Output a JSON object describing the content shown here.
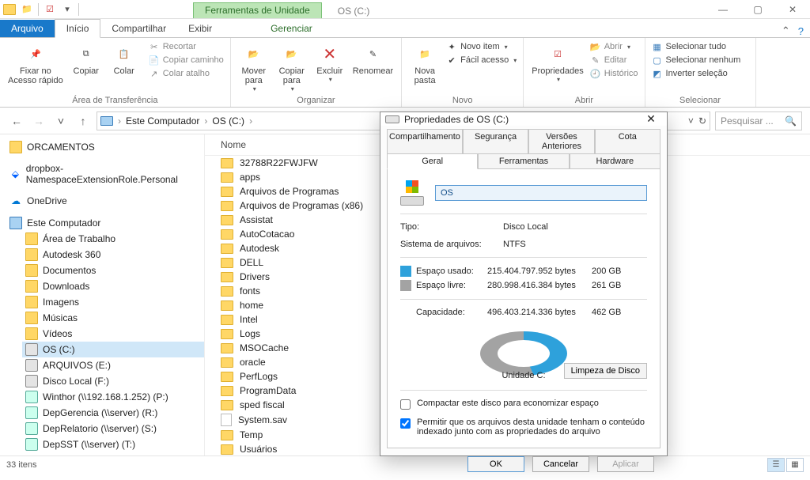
{
  "window": {
    "contextual_tab": "Ferramentas de Unidade",
    "title": "OS (C:)",
    "controls": {
      "min": "—",
      "max": "▢",
      "close": "✕"
    }
  },
  "ribbon_tabs": {
    "file": "Arquivo",
    "home": "Início",
    "share": "Compartilhar",
    "view": "Exibir",
    "manage": "Gerenciar",
    "help": "?",
    "collapse": "⌃"
  },
  "ribbon": {
    "clipboard": {
      "pin": "Fixar no",
      "pin2": "Acesso rápido",
      "copy": "Copiar",
      "paste": "Colar",
      "cut": "Recortar",
      "copy_path": "Copiar caminho",
      "paste_shortcut": "Colar atalho",
      "group": "Área de Transferência"
    },
    "organize": {
      "move_to": "Mover\npara",
      "copy_to": "Copiar\npara",
      "delete": "Excluir",
      "rename": "Renomear",
      "group": "Organizar"
    },
    "new": {
      "new_folder": "Nova\npasta",
      "new_item": "Novo item",
      "easy_access": "Fácil acesso",
      "group": "Novo"
    },
    "open": {
      "properties": "Propriedades",
      "open": "Abrir",
      "edit": "Editar",
      "history": "Histórico",
      "group": "Abrir"
    },
    "select": {
      "all": "Selecionar tudo",
      "none": "Selecionar nenhum",
      "invert": "Inverter seleção",
      "group": "Selecionar"
    }
  },
  "nav": {
    "back": "←",
    "fwd": "→",
    "recent": "˅",
    "up": "↑",
    "root": "Este Computador",
    "current": "OS (C:)",
    "refresh": "↻",
    "dropdown": "˅",
    "search_placeholder": "Pesquisar ...",
    "search_icon": "🔍"
  },
  "tree": {
    "quick": "ORCAMENTOS",
    "dropbox": "dropbox-NamespaceExtensionRole.Personal",
    "onedrive": "OneDrive",
    "this_pc": "Este Computador",
    "children": [
      "Área de Trabalho",
      "Autodesk 360",
      "Documentos",
      "Downloads",
      "Imagens",
      "Músicas",
      "Vídeos",
      "OS (C:)",
      "ARQUIVOS (E:)",
      "Disco Local (F:)",
      "Winthor (\\\\192.168.1.252) (P:)",
      "DepGerencia (\\\\server) (R:)",
      "DepRelatorio (\\\\server) (S:)",
      "DepSST (\\\\server) (T:)"
    ]
  },
  "list": {
    "column": "Nome",
    "items": [
      "32788R22FWJFW",
      "apps",
      "Arquivos de Programas",
      "Arquivos de Programas (x86)",
      "Assistat",
      "AutoCotacao",
      "Autodesk",
      "DELL",
      "Drivers",
      "fonts",
      "home",
      "Intel",
      "Logs",
      "MSOCache",
      "oracle",
      "PerfLogs",
      "ProgramData",
      "sped fiscal",
      "System.sav",
      "Temp",
      "Usuários"
    ]
  },
  "status": {
    "count": "33 itens"
  },
  "dialog": {
    "title": "Propriedades de OS (C:)",
    "tabs": {
      "sharing": "Compartilhamento",
      "security": "Segurança",
      "previous": "Versões Anteriores",
      "quota": "Cota",
      "general": "Geral",
      "tools": "Ferramentas",
      "hardware": "Hardware"
    },
    "drive_name": "OS",
    "type_label": "Tipo:",
    "type_value": "Disco Local",
    "fs_label": "Sistema de arquivos:",
    "fs_value": "NTFS",
    "used_label": "Espaço usado:",
    "used_bytes": "215.404.797.952 bytes",
    "used_h": "200 GB",
    "free_label": "Espaço livre:",
    "free_bytes": "280.998.416.384 bytes",
    "free_h": "261 GB",
    "cap_label": "Capacidade:",
    "cap_bytes": "496.403.214.336 bytes",
    "cap_h": "462 GB",
    "drive_label": "Unidade C:",
    "cleanup": "Limpeza de Disco",
    "compress": "Compactar este disco para economizar espaço",
    "index": "Permitir que os arquivos desta unidade tenham o conteúdo indexado junto com as propriedades do arquivo",
    "ok": "OK",
    "cancel": "Cancelar",
    "apply": "Aplicar"
  },
  "chart_data": {
    "type": "pie",
    "title": "Unidade C:",
    "categories": [
      "Espaço usado",
      "Espaço livre"
    ],
    "values": [
      215404797952,
      280998416384
    ],
    "series_colors": [
      "#2ea1db",
      "#a3a3a3"
    ],
    "labels_h": [
      "200 GB",
      "261 GB"
    ],
    "total": 496403214336,
    "total_h": "462 GB"
  }
}
